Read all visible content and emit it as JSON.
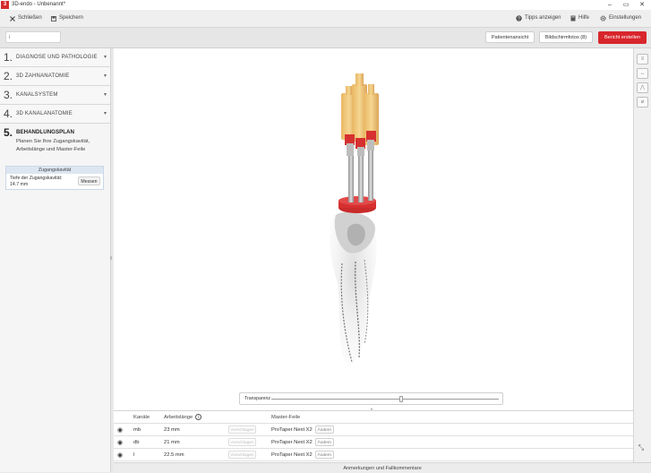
{
  "window": {
    "title": "3D-endo - Unbenannt*",
    "minimize": "–",
    "maximize": "▭",
    "close": "✕"
  },
  "toolbar": {
    "close_label": "Schließen",
    "save_label": "Speichern",
    "tips_label": "Tipps anzeigen",
    "help_label": "Hilfe",
    "settings_label": "Einstellungen"
  },
  "bar2": {
    "search_value": "i",
    "patient_view": "Patientenansicht",
    "screenshots": "Bildschirmfotos (8)",
    "report": "Bericht erstellen"
  },
  "sidebar": {
    "steps": [
      {
        "num": "1.",
        "label": "DIAGNOSE UND PATHOLOGIE"
      },
      {
        "num": "2.",
        "label": "3D ZAHNANATOMIE"
      },
      {
        "num": "3.",
        "label": "KANALSYSTEM"
      },
      {
        "num": "4.",
        "label": "3D KANALANATOMIE"
      }
    ],
    "active_step": {
      "num": "5.",
      "label": "BEHANDLUNGSPLAN",
      "description": "Planen Sie Ihre Zugangskavität, Arbeitslänge und Master-Feile"
    },
    "access": {
      "header": "Zugangskavität",
      "depth_label": "Tiefe der Zugangskavität:",
      "depth_value": "14.7 mm",
      "measure_button": "Messen"
    }
  },
  "viewer": {
    "transparency_label": "Transparenz",
    "transparency_value": 0.57
  },
  "table": {
    "headers": {
      "canals": "Kanäle",
      "working_length": "Arbeitslänge",
      "info": "i",
      "master_file": "Master-Feile"
    },
    "suggest_label": "Vorschlagen",
    "change_label": "Ändern",
    "rows": [
      {
        "canal": "mb",
        "length": "23 mm",
        "file": "ProTaper Next X2"
      },
      {
        "canal": "db",
        "length": "21 mm",
        "file": "ProTaper Next X2"
      },
      {
        "canal": "l",
        "length": "22.5 mm",
        "file": "ProTaper Next X2"
      }
    ]
  },
  "footer": {
    "label": "Anmerkungen und Fallkommentare"
  },
  "colors": {
    "accent": "#d8262b",
    "file_handle": "#f0c77a",
    "stopper": "#d63030"
  }
}
